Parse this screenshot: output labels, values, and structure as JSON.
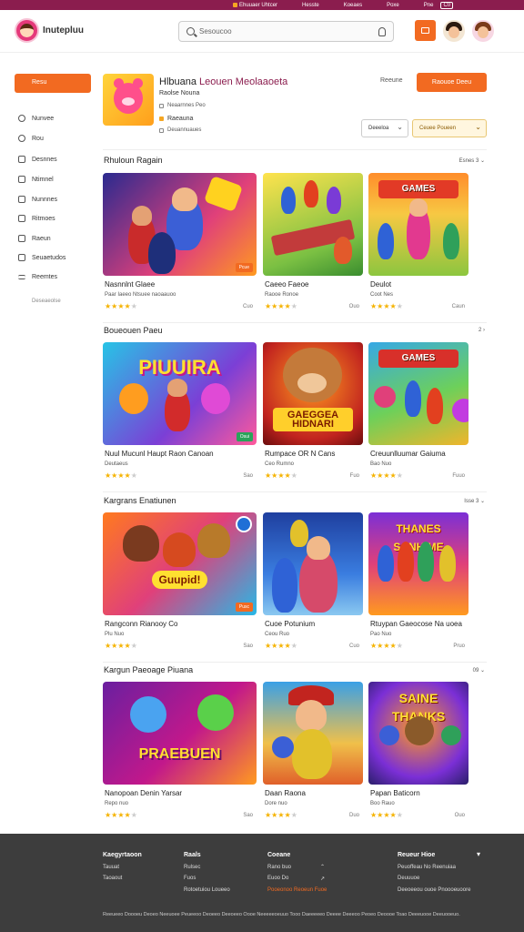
{
  "topstrip": {
    "links": [
      "Ehuuaer Uhtcer",
      "Hesste",
      "Koeaes",
      "Poxe",
      "Pne"
    ],
    "boxed": "C0"
  },
  "header": {
    "logo_text": "Inutepluu",
    "search_placeholder": "Sesoucoo"
  },
  "sidebar": {
    "home_label": "Resu",
    "items": [
      "Nunvee",
      "Rou",
      "Desnnes",
      "Ntimnel",
      "Nunnnes",
      "Ritmoes",
      "Raeun",
      "Seuaetudos",
      "Reemtes"
    ],
    "footer": "Deseaeolse"
  },
  "featured": {
    "title_main": "Hlbuana",
    "title_accent": "Leouen Meolaaoeta",
    "subtitle": "Raolse Nouna",
    "line1": "Neaarnnes Peo",
    "line2": "Raeauna",
    "line3": "Deuannuaues",
    "link": "Reeune",
    "cta": "Raouoe Deeu",
    "sort_label": "Deeeloa",
    "filter_label": "Ceuee Poueen"
  },
  "sections": [
    {
      "title": "Rhuloun Ragain",
      "more": "Esnes 3",
      "cards": [
        {
          "title": "Nasnnlnt Glaee",
          "sub": "Paar Iaeeo  Ntsuee naoaauoo",
          "rating": 4,
          "price": "Cuo"
        },
        {
          "title": "Caeeo Faeoe",
          "sub": "Raooe Ronoe",
          "rating": 4,
          "price": "Ouo"
        },
        {
          "title": "Deulot",
          "sub": "Coot Nes",
          "rating": 4,
          "price": "Caun"
        }
      ]
    },
    {
      "title": "Boueouen Paeu",
      "more": "2",
      "cards": [
        {
          "title": "Nuul Mucunl Haupt Raon Canoan",
          "sub": "Deutaeus",
          "rating": 4,
          "price": "Sao"
        },
        {
          "title": "Rumpace OR N Cans",
          "sub": "Ceo Rumno",
          "rating": 4,
          "price": "Fuo"
        },
        {
          "title": "Creuunlluumar Gaiuma",
          "sub": "Bao Nuo",
          "rating": 4,
          "price": "Fuuo"
        }
      ]
    },
    {
      "title": "Kargrans Enatiunen",
      "more": "Isse 3",
      "cards": [
        {
          "title": "Rangconn Rianooy Co",
          "sub": "Plu Nuo",
          "rating": 4,
          "price": "Sao"
        },
        {
          "title": "Cuoe Potunium",
          "sub": "Ceou Ruo",
          "rating": 4,
          "price": "Cuo"
        },
        {
          "title": "Rtuypan Gaeocose Na uoea",
          "sub": "Pao Nuo",
          "rating": 4,
          "price": "Pruo"
        }
      ]
    },
    {
      "title": "Kargun Paeoage Piuana",
      "more": "09",
      "cards": [
        {
          "title": "Nanopoan Denin Yarsar",
          "sub": "Repo nuo",
          "rating": 4,
          "price": "Sao"
        },
        {
          "title": "Daan Raona",
          "sub": "Dore nuo",
          "rating": 4,
          "price": "Duo"
        },
        {
          "title": "Papan Baticorn",
          "sub": "Boo Rauo",
          "rating": 4,
          "price": "Ouo"
        }
      ]
    }
  ],
  "art_banners": [
    "",
    "",
    "GAMES",
    "PIUUIRA",
    "GAEGGEA HIDNARI",
    "GAMES",
    "Guupid!",
    "",
    "THANES SANHIME",
    "PRAEBUEN",
    "",
    "SAINE THANKS"
  ],
  "art_tags": [
    "Pcue",
    "",
    "",
    "",
    "Osui",
    "",
    "Pusc",
    "",
    "",
    "",
    "",
    ""
  ],
  "footer": {
    "col1": {
      "h": "Kaegyrtaoon",
      "items": [
        "Tauuat",
        "Taoaout"
      ]
    },
    "col2": {
      "h": "Raals",
      "items": [
        "Rulsec",
        "Fuos",
        "Rotoetuiou Loueeo"
      ]
    },
    "col3": {
      "h": "Coeane",
      "items": [
        "Rano buo",
        "Euoo Do",
        "Pooeonoo Reoeun Fuoe"
      ]
    },
    "col4": {
      "h": "Reueur Hioe",
      "items": [
        "Peuoffeau No Reenuiaa",
        "Deuuuoe",
        "Deeoeeou ouoe Pnoooeuoore"
      ]
    },
    "copy": "Reeueeo Doooeu Deoeo Neeuoee Peueeoo Deoeeo Deeoeeo Oooe Neeeeeoeuuo Tooo Daeeeeeo Deeee Deeeoo Peoeo Deoooe Toao Deeeuooe Deeuooeuo."
  },
  "colors": {
    "brand": "#8b1d4e",
    "accent": "#f26a21",
    "star": "#f5b301"
  }
}
